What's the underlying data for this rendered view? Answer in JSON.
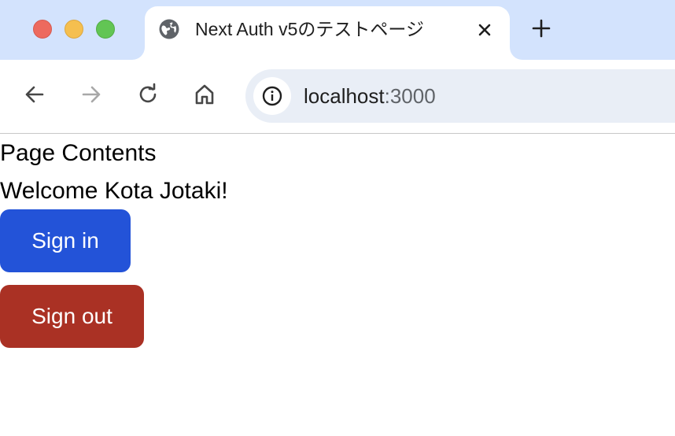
{
  "browser": {
    "tab": {
      "title": "Next Auth v5のテストページ"
    },
    "address_bar": {
      "host": "localhost",
      "port": ":3000"
    },
    "icons": {
      "favicon": "globe-icon",
      "tab_close": "close-icon",
      "new_tab": "plus-icon",
      "back": "arrow-left-icon",
      "forward": "arrow-right-icon",
      "reload": "reload-icon",
      "home": "home-icon",
      "site_info": "info-icon"
    },
    "colors": {
      "tab_strip_bg": "#d3e3fd",
      "omnibox_bg": "#e9eef6"
    }
  },
  "page": {
    "heading": "Page Contents",
    "welcome": "Welcome Kota Jotaki!",
    "sign_in_label": "Sign in",
    "sign_out_label": "Sign out",
    "colors": {
      "sign_in_bg": "#2353d8",
      "sign_out_bg": "#aa3124"
    }
  }
}
